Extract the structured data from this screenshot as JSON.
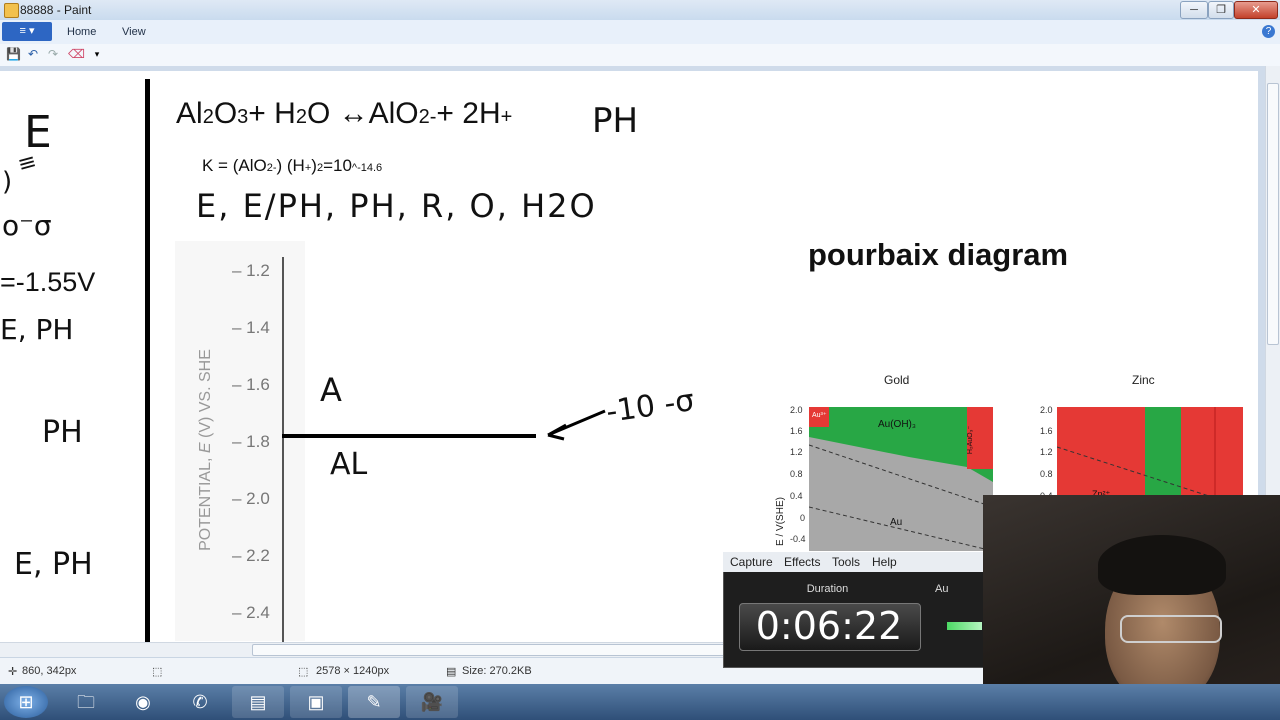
{
  "window": {
    "title": "88888 - Paint",
    "min": "─",
    "max": "❐",
    "close": "✕"
  },
  "ribbon": {
    "menu_label": "≡ ▾",
    "tabs": [
      "Home",
      "View"
    ],
    "help": "?"
  },
  "quickbar": {
    "save": "💾",
    "undo": "↶",
    "redo": "↷",
    "eraser": "⌫",
    "more": "▾"
  },
  "canvas": {
    "left": {
      "e": "E",
      "eq_sign": "≡",
      "paren": ")",
      "ten": "o⁻σ",
      "volt": "=-1.55V",
      "eph1": "E, PH",
      "ph": "PH",
      "eph2": "E, PH"
    },
    "equation": {
      "p1": "Al",
      "s1": "2",
      "p2": "O",
      "s2": "3",
      "p3": "+ H",
      "s3": "2",
      "p4": "O ↔AlO",
      "s4": "2-",
      "p5": "+ 2H",
      "s5": "+",
      "hand_ph": "PH"
    },
    "k_eq": {
      "k1": "K = (AlO",
      "k1s": "2-",
      "k2": ") (H",
      "k2s": "+",
      "k3": ")",
      "k3s": "2",
      "k4": "=10",
      "k4s": "^-14.6"
    },
    "vars": "E, E/PH, PH, R, O, H2O",
    "plot": {
      "ylabel_parts": [
        "POTENTIAL, ",
        "E",
        " (V) VS. SHE"
      ],
      "ticks": [
        "– 1.2",
        "– 1.4",
        "– 1.6",
        "– 1.8",
        "– 2.0",
        "– 2.2",
        "– 2.4"
      ],
      "label_a": "A",
      "label_al": "AL",
      "arrow_note": "-10 -σ"
    },
    "pourbaix": {
      "title": "pourbaix diagram",
      "gold": {
        "title": "Gold",
        "ticks": [
          "2.0",
          "1.6",
          "1.2",
          "0.8",
          "0.4",
          "0",
          "-0.4"
        ],
        "region_auoh": "Au(OH)₃",
        "region_au": "Au",
        "region_au3": "Au³⁺",
        "region_h": "H₂AuO₃⁻",
        "ylabel": "E / V(SHE)"
      },
      "zinc": {
        "title": "Zinc",
        "ticks": [
          "2.0",
          "1.6",
          "1.2",
          "0.8",
          "0.4"
        ],
        "region_zn": "Zn²⁺"
      }
    }
  },
  "status": {
    "cursor": "860, 342px",
    "dims": "2578 × 1240px",
    "size": "Size: 270.2KB"
  },
  "recorder": {
    "menu": [
      "Capture",
      "Effects",
      "Tools",
      "Help"
    ],
    "duration_label": "Duration",
    "duration": "0:06:22",
    "audio_label": "Au"
  },
  "taskbar": {
    "start": "⊞",
    "items": [
      "🗀",
      "◉",
      "✆",
      "▤",
      "▣",
      "✎",
      "🎥"
    ]
  }
}
